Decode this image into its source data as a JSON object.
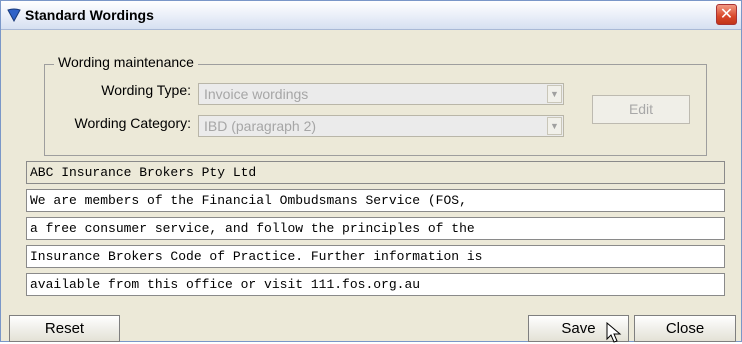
{
  "window": {
    "title": "Standard Wordings",
    "close_glyph": "✕"
  },
  "group": {
    "legend": "Wording maintenance",
    "wording_type_label": "Wording Type:",
    "wording_type_value": "Invoice wordings",
    "wording_category_label": "Wording Category:",
    "wording_category_value": "IBD (paragraph 2)",
    "edit_label": "Edit"
  },
  "text_lines": [
    "ABC Insurance Brokers Pty Ltd",
    "We are members of the Financial Ombudsmans Service (FOS,",
    "a free consumer service, and follow the principles of the",
    "Insurance Brokers Code of Practice. Further information is",
    "available from this office or visit 111.fos.org.au"
  ],
  "buttons": {
    "reset": "Reset",
    "save": "Save",
    "close": "Close"
  },
  "icons": {
    "title_icon": "heart-shield-icon",
    "combo_arrow": "chevron-down-icon",
    "cursor": "mouse-pointer-icon"
  }
}
